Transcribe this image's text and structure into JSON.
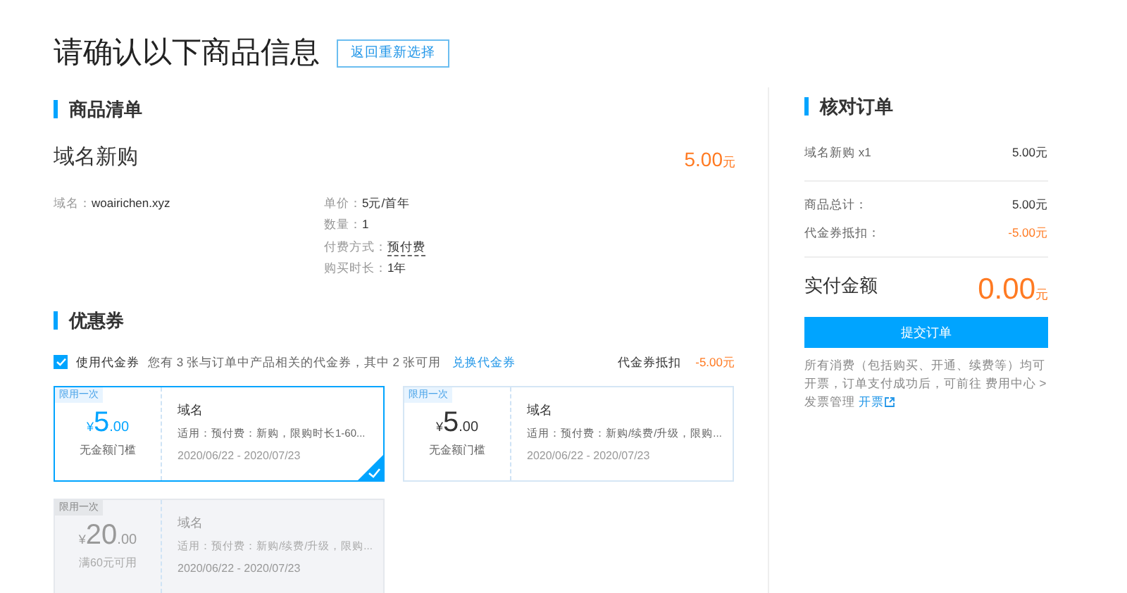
{
  "header": {
    "title": "请确认以下商品信息",
    "back_button": "返回重新选择"
  },
  "goods": {
    "heading": "商品清单",
    "product": "域名新购",
    "price": "5.00",
    "unit": "元",
    "left_fields": [
      {
        "label": "域名：",
        "value": "woairichen.xyz"
      }
    ],
    "right_fields": [
      {
        "label": "单价：",
        "value": "5元/首年",
        "dotted": false
      },
      {
        "label": "数量：",
        "value": "1",
        "dotted": false
      },
      {
        "label": "付费方式：",
        "value": "预付费",
        "dotted": true
      },
      {
        "label": "购买时长：",
        "value": "1年",
        "dotted": false
      }
    ]
  },
  "coupons": {
    "heading": "优惠券",
    "use_checkbox": {
      "label": "使用代金券",
      "checked": true
    },
    "info": "您有 3 张与订单中产品相关的代金券，其中 2 张可用",
    "exchange_link": "兑换代金券",
    "discount_label": "代金券抵扣",
    "discount_value": "-5.00元",
    "items": [
      {
        "tag": "限用一次",
        "currency": "¥",
        "integer": "5",
        "decimal": ".00",
        "condition": "无金额门槛",
        "name": "域名",
        "scope": "适用：预付费：新购，限购时长1-60...",
        "period": "2020/06/22 - 2020/07/23",
        "selected": true,
        "disabled": false
      },
      {
        "tag": "限用一次",
        "currency": "¥",
        "integer": "5",
        "decimal": ".00",
        "condition": "无金额门槛",
        "name": "域名",
        "scope": "适用：预付费：新购/续费/升级，限购...",
        "period": "2020/06/22 - 2020/07/23",
        "selected": false,
        "disabled": false
      },
      {
        "tag": "限用一次",
        "currency": "¥",
        "integer": "20",
        "decimal": ".00",
        "condition": "满60元可用",
        "name": "域名",
        "scope": "适用：预付费：新购/续费/升级，限购...",
        "period": "2020/06/22 - 2020/07/23",
        "selected": false,
        "disabled": true
      }
    ]
  },
  "order": {
    "heading": "核对订单",
    "line_item": {
      "label": "域名新购 x1",
      "value": "5.00元"
    },
    "totals": [
      {
        "label": "商品总计：",
        "value": "5.00元",
        "negative": false
      },
      {
        "label": "代金券抵扣：",
        "value": "-5.00元",
        "negative": true
      }
    ],
    "pay_label": "实付金额",
    "pay_amount": "0.00",
    "pay_unit": "元",
    "submit_button": "提交订单",
    "note": "所有消费（包括购买、开通、续费等）均可开票，订单支付成功后，可前往 费用中心 > 发票管理",
    "invoice_link": "开票"
  }
}
